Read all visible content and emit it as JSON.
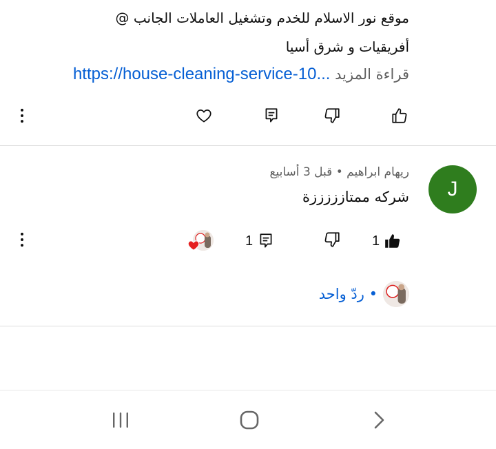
{
  "description": {
    "line1": "موقع نور الاسلام للخدم وتشغيل العاملات الجانب @",
    "line2": "أفريقيات  و شرق أسيا",
    "read_more_label": "قراءة المزيد",
    "link_text": "https://house-cleaning-service-10..."
  },
  "post_actions": {
    "like_icon": "thumb-up-icon",
    "dislike_icon": "thumb-down-icon",
    "comments_icon": "comment-icon",
    "heart_icon": "heart-icon",
    "more_icon": "more-vert-icon"
  },
  "comment": {
    "avatar_letter": "J",
    "avatar_color": "#2f7d1e",
    "meta": "ريهام ابراهيم • قبل 3 أسابيع",
    "text": "شركه ممتازززززة",
    "like_count": "1",
    "reply_count": "1"
  },
  "replies": {
    "label": "• ردّ واحد"
  },
  "colors": {
    "link": "#065fd4",
    "secondary_text": "#606060",
    "divider": "#dcdcdc",
    "heart": "#e52020"
  }
}
